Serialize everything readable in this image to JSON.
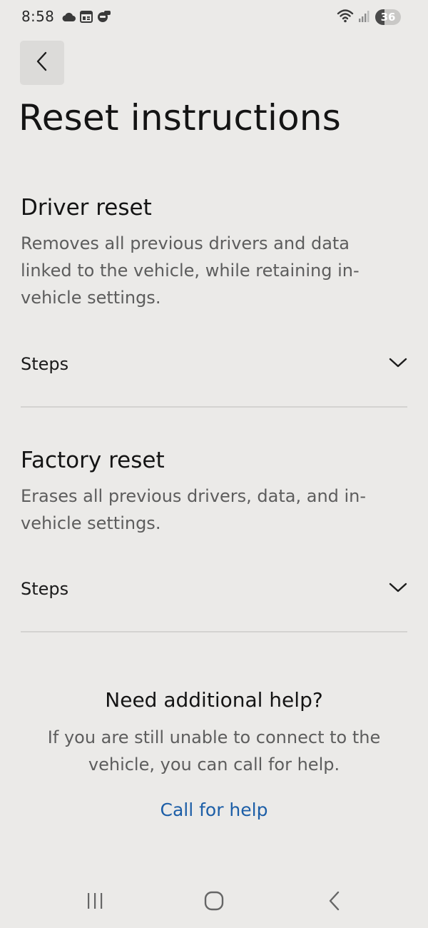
{
  "status_bar": {
    "time": "8:58",
    "battery_level": "36",
    "left_icons": [
      "cloud-icon",
      "calendar-news-icon",
      "pluto-tv-icon"
    ],
    "right_icons": [
      "wifi-icon",
      "signal-icon",
      "battery-icon"
    ]
  },
  "header": {
    "back_icon": "chevron-left-icon",
    "title": "Reset instructions"
  },
  "driver_reset": {
    "title": "Driver reset",
    "description": "Removes all previous drivers and data linked to the vehicle, while retaining in-vehicle settings.",
    "steps_label": "Steps",
    "expand_icon": "chevron-down-icon"
  },
  "factory_reset": {
    "title": "Factory reset",
    "description": "Erases all previous drivers, data, and in-vehicle settings.",
    "steps_label": "Steps",
    "expand_icon": "chevron-down-icon"
  },
  "help": {
    "title": "Need additional help?",
    "description": "If you are still unable to connect to the vehicle, you can call for help.",
    "call_link": "Call for help"
  },
  "navigation": {
    "buttons": [
      "recent-apps-icon",
      "home-icon",
      "back-icon"
    ]
  },
  "colors": {
    "background": "#ebeae8",
    "link": "#1c5ea7",
    "body_text": "#5d5d5d",
    "divider": "#d4d3d1"
  }
}
